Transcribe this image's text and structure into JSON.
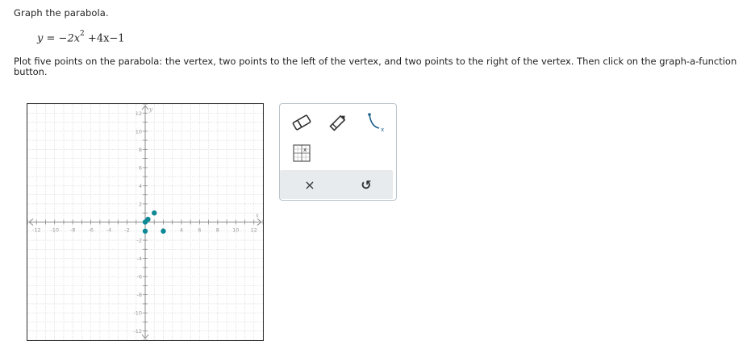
{
  "question": {
    "title": "Graph the parabola.",
    "equation_lhs": "y",
    "equation_eq": "=",
    "equation_rhs_a": "−2x",
    "equation_exp": "2",
    "equation_rhs_b": "+4x−1",
    "instruction_line1": "Plot five points on the parabola: the vertex, two points to the left of the vertex, and two points to the right of the vertex. Then click on the graph-a-function",
    "instruction_line2": "button."
  },
  "graph": {
    "x_axis_label": "x",
    "y_axis_label": "y",
    "x_range": [
      -13,
      13
    ],
    "y_range": [
      -13,
      13
    ],
    "x_tick_labels": [
      "-12",
      "-10",
      "-8",
      "-6",
      "-4",
      "-2",
      "2",
      "4",
      "6",
      "8",
      "10",
      "12"
    ],
    "y_tick_labels": [
      "12",
      "10",
      "8",
      "6",
      "4",
      "2",
      "-2",
      "-4",
      "-6",
      "-8",
      "-10",
      "-12"
    ],
    "grid": true,
    "points": [
      {
        "x": 0,
        "y": -1
      },
      {
        "x": 1,
        "y": 1
      },
      {
        "x": 2,
        "y": -1
      },
      {
        "x": 0,
        "y": 0
      },
      {
        "x": 0.3,
        "y": 0.3
      }
    ],
    "point_color": "#0e8a96"
  },
  "toolbar": {
    "tools": [
      "eraser-icon",
      "pencil-icon",
      "graph-a-function-icon",
      "point-grid-icon"
    ],
    "actions": [
      "clear-icon",
      "undo-icon"
    ],
    "clear_label": "×",
    "undo_label": "↺"
  }
}
